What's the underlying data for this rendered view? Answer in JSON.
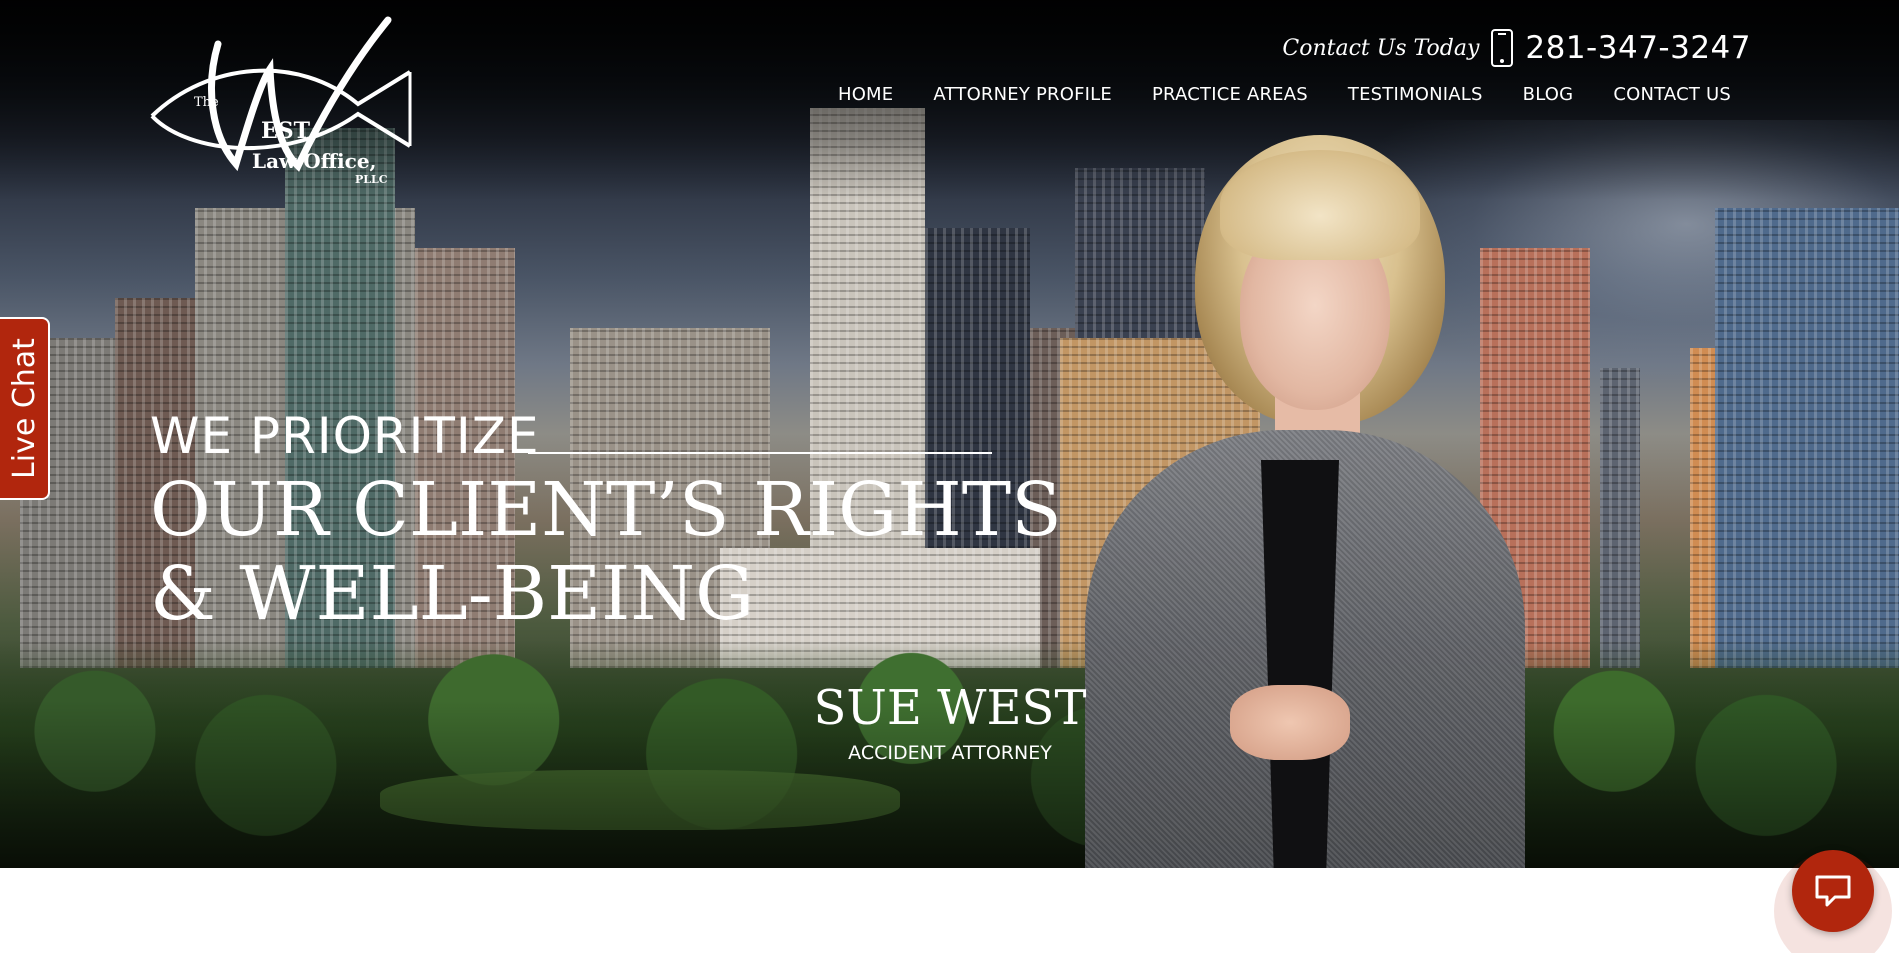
{
  "logo": {
    "line_the": "The",
    "line_west": "EST",
    "line_law": "Law Office,",
    "line_pllc": "PLLC",
    "letter_w": "W"
  },
  "header": {
    "contact_label": "Contact Us Today",
    "phone_icon": "phone-icon",
    "phone": "281-347-3247",
    "nav": [
      {
        "label": "HOME"
      },
      {
        "label": "ATTORNEY PROFILE"
      },
      {
        "label": "PRACTICE AREAS"
      },
      {
        "label": "TESTIMONIALS"
      },
      {
        "label": "BLOG"
      },
      {
        "label": "CONTACT US"
      }
    ]
  },
  "hero": {
    "tagline_small": "WE PRIORITIZE",
    "tagline_line1": "OUR CLIENT’S RIGHTS",
    "tagline_line2": "& WELL-BEING",
    "attorney_name": "SUE WEST",
    "attorney_title": "ACCIDENT ATTORNEY"
  },
  "live_chat": {
    "label": "Live Chat"
  },
  "chat_button": {
    "icon": "chat-bubble-icon"
  },
  "colors": {
    "accent": "#b1260d",
    "text_on_hero": "#ffffff"
  }
}
